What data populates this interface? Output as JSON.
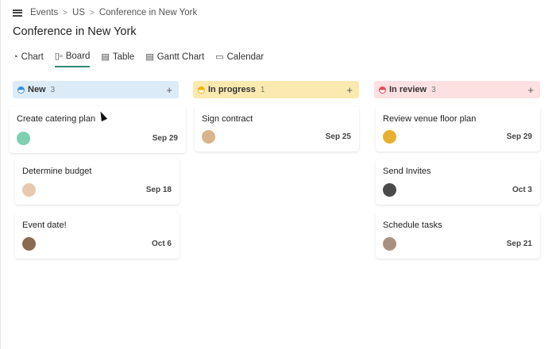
{
  "breadcrumb": [
    "Events",
    "US",
    "Conference in New York"
  ],
  "page_title": "Conference in New York",
  "tabs": [
    {
      "label": "Chart",
      "icon": "pie-chart-icon"
    },
    {
      "label": "Board",
      "icon": "board-icon",
      "active": true
    },
    {
      "label": "Table",
      "icon": "table-icon"
    },
    {
      "label": "Gantt Chart",
      "icon": "gantt-icon"
    },
    {
      "label": "Calendar",
      "icon": "calendar-icon"
    }
  ],
  "columns": [
    {
      "name": "New",
      "count": "3",
      "bg": "#dcebf8",
      "dot": "#3b8fe0",
      "cards": [
        {
          "title": "Create catering plan",
          "date": "Sep 29",
          "avatar": "#7fcfb0"
        },
        {
          "title": "Determine budget",
          "date": "Sep 18",
          "avatar": "#e8c9b0"
        },
        {
          "title": "Event date!",
          "date": "Oct 6",
          "avatar": "#8a6a50"
        }
      ]
    },
    {
      "name": "In progress",
      "count": "1",
      "bg": "#fbeab0",
      "dot": "#f0b400",
      "cards": [
        {
          "title": "Sign contract",
          "date": "Sep 25",
          "avatar": "#d9b48c"
        }
      ]
    },
    {
      "name": "In review",
      "count": "3",
      "bg": "#fde0e2",
      "dot": "#e84858",
      "cards": [
        {
          "title": "Review venue floor plan",
          "date": "Sep 29",
          "avatar": "#e8b030"
        },
        {
          "title": "Send Invites",
          "date": "Oct 3",
          "avatar": "#4a4a4a"
        },
        {
          "title": "Schedule tasks",
          "date": "Sep 21",
          "avatar": "#a89080"
        }
      ]
    }
  ]
}
